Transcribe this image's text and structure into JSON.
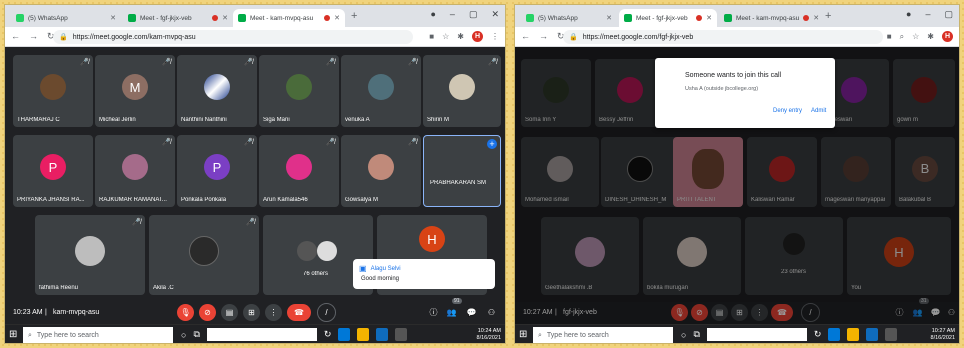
{
  "left": {
    "tabs": [
      {
        "label": "(5) WhatsApp",
        "favicon_color": "#25d366"
      },
      {
        "label": "Meet - fgf-jkjx-veb",
        "favicon_color": "#00ac47"
      },
      {
        "label": "Meet - kam-mvpq-asu",
        "favicon_color": "#00ac47"
      }
    ],
    "url": "https://meet.google.com/kam-mvpq-asu",
    "profile_initial": "H",
    "tiles_row1": [
      "THARMARAJ C",
      "Micheal Jerlin",
      "Nanthini Nanthini",
      "Siga Mani",
      "venuka A",
      "Shirin M"
    ],
    "tiles_row2": [
      "PRIYANKA JHANSI RA...",
      "RAJKUMAR RAMANAT...",
      "Ponkala Ponkala",
      "Arun Kamala546",
      "Gowsalya M",
      "PRABHAKARAN SM"
    ],
    "tiles_row3": [
      "fathima Reenu",
      "Akila .C",
      "76 others"
    ],
    "letters": {
      "micheal": "M",
      "priyanka": "P",
      "ponkala": "P",
      "self": "H"
    },
    "toast": {
      "name": "Alagu Selvi",
      "message": "Good morning"
    },
    "meeting_time": "10:23 AM",
    "meeting_code": "kam-mvpq-asu",
    "participant_badge": "91",
    "search_placeholder": "Type here to search",
    "clock_time": "10:24 AM",
    "clock_date": "8/16/2021"
  },
  "right": {
    "tabs": [
      {
        "label": "(5) WhatsApp",
        "favicon_color": "#25d366"
      },
      {
        "label": "Meet - fgf-jkjx-veb",
        "favicon_color": "#00ac47"
      },
      {
        "label": "Meet - kam-mvpq-asu",
        "favicon_color": "#00ac47"
      }
    ],
    "url": "https://meet.google.com/fgf-jkjx-veb",
    "profile_initial": "H",
    "popup": {
      "title": "Someone wants to join this call",
      "subtitle": "Usha A (outside jbcollege.org)",
      "deny": "Deny entry",
      "admit": "Admit"
    },
    "tiles_row1": [
      "Soma Irin Y",
      "Bessy Jeffrin",
      "",
      "Maheswari",
      "gowri m"
    ],
    "tiles_row2": [
      "Mohamed ismail",
      "DINESH_DHINESH_M",
      "PRITI TALENT",
      "Kaliswari Ramar",
      "mageswari mariyappan",
      "Balakubal B"
    ],
    "tiles_row3": [
      "Geethalakshmi .B",
      "bokila murugan",
      "23 others",
      "You"
    ],
    "letters": {
      "balakubal": "B",
      "you": "H"
    },
    "meeting_time": "10:27 AM",
    "meeting_code": "fgf-jkjx-veb",
    "participant_badge": "31",
    "search_placeholder": "Type here to search",
    "clock_time": "10:27 AM",
    "clock_date": "8/16/2021"
  }
}
